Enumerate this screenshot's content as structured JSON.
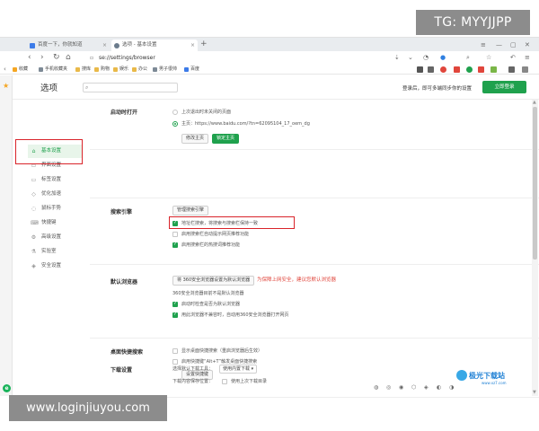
{
  "overlays": {
    "top_tag": "TG: MYYJJPP",
    "bottom_site": "www.loginjiuyou.com"
  },
  "tabs": [
    {
      "label": "百度一下，你就知道"
    },
    {
      "label": "选项 - 基本设置"
    }
  ],
  "address_bar": {
    "url": "se://settings/browser"
  },
  "bookmarks": [
    "收藏",
    "手机收藏夹",
    "搜库",
    "购物",
    "娱乐",
    "办公",
    "男子很帅",
    "百度"
  ],
  "header": {
    "title": "选项",
    "search_placeholder": "",
    "login_tip": "登录后，即可多端同步你的设置",
    "login_button": "立即登录"
  },
  "sidebar": {
    "items": [
      {
        "label": "基本设置",
        "active": true,
        "icon": "home-icon"
      },
      {
        "label": "界面设置",
        "icon": "layout-icon"
      },
      {
        "label": "标签设置",
        "icon": "tab-icon"
      },
      {
        "label": "优化加速",
        "icon": "rocket-icon"
      },
      {
        "label": "鼠标手势",
        "icon": "mouse-icon"
      },
      {
        "label": "快捷键",
        "icon": "keyboard-icon"
      },
      {
        "label": "高级设置",
        "icon": "gear-icon"
      },
      {
        "label": "实验室",
        "icon": "lab-icon"
      },
      {
        "label": "安全设置",
        "icon": "shield-icon"
      }
    ]
  },
  "sections": {
    "startup": {
      "title": "启动时打开",
      "option_last": "上次退出时未关闭的页面",
      "option_home": "主页：https://www.baidu.com/?tn=62095104_17_oem_dg",
      "modify_btn": "修改主页",
      "lock_btn": "锁定主页"
    },
    "search": {
      "title": "搜索引擎",
      "manage_btn": "管理搜索引擎",
      "opt1": "地址栏搜索，将搜索与搜索栏保持一致",
      "opt2": "启用搜索栏自动提示网页推荐功能",
      "opt3": "启用搜索栏的热搜词推荐功能"
    },
    "default_browser": {
      "title": "默认浏览器",
      "set_btn": "将 360安全浏览器设置为默认浏览器",
      "warning": "为保障上网安全，建议您默认浏览器",
      "status": "360安全浏览器目前不是默认浏览器",
      "opt1": "启动时检查是否为默认浏览器",
      "opt2": "用此浏览器不兼容时，自动用360安全浏览器打开网页"
    },
    "desktop_search": {
      "title": "桌面快捷搜索",
      "opt1": "显示桌面快捷搜索（重启浏览器后生效）",
      "opt2": "启用快捷键“Alt+T”触发桌面快捷搜索",
      "set_btn": "设置快捷键"
    },
    "download": {
      "title": "下载设置",
      "tool_label": "选择默认下载工具：",
      "tool_value": "使用内置下载",
      "location_label": "下载内容保存位置：",
      "location_option": "使用上次下载目录"
    }
  },
  "watermark": {
    "brand": "极光下载站",
    "url": "www.xz7.com"
  },
  "colors": {
    "accent": "#1fa14d",
    "highlight_box": "#d9242a",
    "warning": "#e0463c"
  }
}
